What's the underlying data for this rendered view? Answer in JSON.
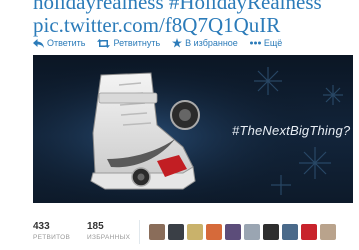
{
  "tweet": {
    "line1": "holidayrealness #HolidayRealness",
    "line2": "pic.twitter.com/f8Q7Q1QuIR"
  },
  "actions": {
    "reply": "Ответить",
    "retweet": "Ретвитнуть",
    "favorite": "В избранное",
    "more": "Ещё"
  },
  "media": {
    "hashtag": "#TheNextBigThing?"
  },
  "stats": {
    "retweets_count": "433",
    "retweets_label": "РЕТВИТОВ",
    "favorites_count": "185",
    "favorites_label": "ИЗБРАННЫХ"
  },
  "avatars": [
    {
      "color": "#8a6d5a"
    },
    {
      "color": "#3a3f46"
    },
    {
      "color": "#c9b26b"
    },
    {
      "color": "#d66a3a"
    },
    {
      "color": "#5c4d7a"
    },
    {
      "color": "#9aa5b2"
    },
    {
      "color": "#2e2e2e"
    },
    {
      "color": "#4a6a8a"
    },
    {
      "color": "#c8232c"
    },
    {
      "color": "#b9a38c"
    }
  ],
  "colors": {
    "link": "#2b7bb9",
    "media_bg": "#0b1624"
  }
}
